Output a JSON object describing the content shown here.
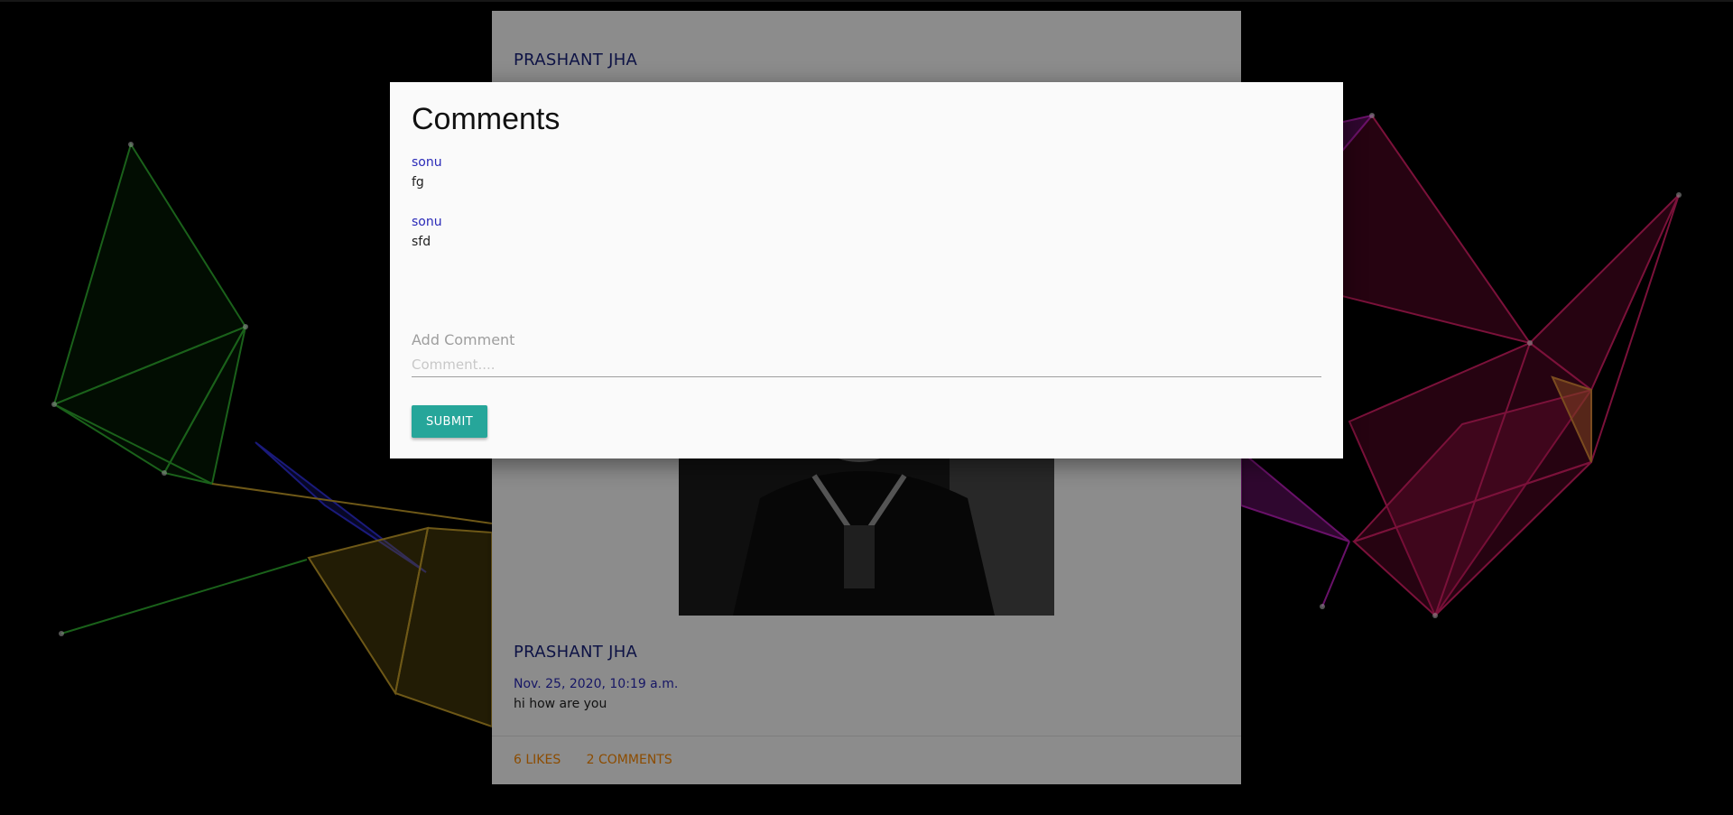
{
  "post": {
    "author_top": "PRASHANT JHA",
    "author_bottom": "PRASHANT JHA",
    "date": "Nov. 25, 2020, 10:19 a.m.",
    "text": "hi how are you",
    "likes_label": "6 LIKES",
    "comments_label": "2 COMMENTS"
  },
  "modal": {
    "title": "Comments",
    "comments": [
      {
        "user": "sonu",
        "text": "fg"
      },
      {
        "user": "sonu",
        "text": "sfd"
      }
    ],
    "add_comment_label": "Add Comment",
    "input_placeholder": "Comment....",
    "submit_label": "SUBMIT"
  },
  "colors": {
    "accent_teal": "#26a69a",
    "link_blue": "#2a2ab8",
    "action_orange": "#ff8a00",
    "author_navy": "#1a237e"
  }
}
